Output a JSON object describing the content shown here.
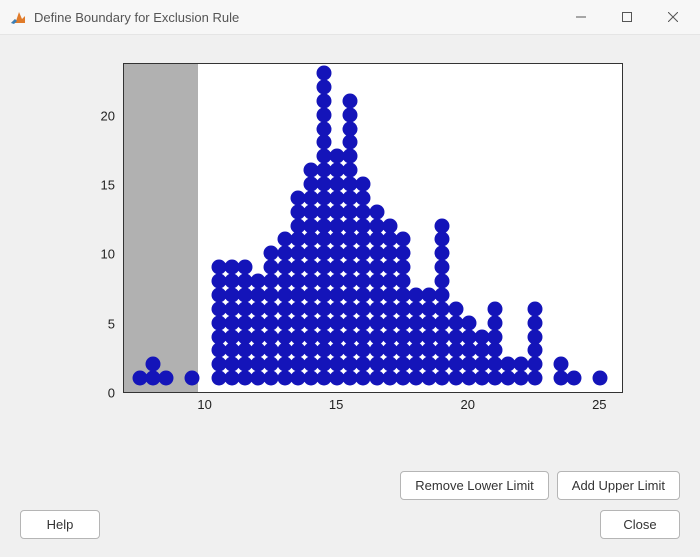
{
  "window": {
    "title": "Define Boundary for Exclusion Rule"
  },
  "buttons": {
    "remove_lower": "Remove Lower Limit",
    "add_upper": "Add Upper Limit",
    "help": "Help",
    "close": "Close"
  },
  "chart_data": {
    "type": "scatter",
    "title": "",
    "xlabel": "",
    "ylabel": "",
    "xlim": [
      6.9,
      25.9
    ],
    "ylim": [
      0,
      23.8
    ],
    "xticks": [
      10,
      15,
      20,
      25
    ],
    "yticks": [
      0,
      5,
      10,
      15,
      20
    ],
    "lower_limit": 9.7,
    "x": [
      7.5,
      8,
      8.5,
      8,
      9.5,
      10.5,
      10.5,
      10.5,
      10.5,
      10.5,
      10.5,
      10.5,
      10.5,
      10.5,
      11,
      11,
      11,
      11,
      11,
      11,
      11,
      11,
      11,
      11.5,
      11.5,
      11.5,
      11.5,
      11.5,
      11.5,
      11.5,
      11.5,
      11.5,
      12,
      12,
      12,
      12,
      12,
      12,
      12,
      12,
      12.5,
      12.5,
      12.5,
      12.5,
      12.5,
      12.5,
      12.5,
      12.5,
      12.5,
      12.5,
      13,
      13,
      13,
      13,
      13,
      13,
      13,
      13,
      13,
      13,
      13,
      13.5,
      13.5,
      13.5,
      13.5,
      13.5,
      13.5,
      13.5,
      13.5,
      13.5,
      13.5,
      13.5,
      13.5,
      13.5,
      13.5,
      14,
      14,
      14,
      14,
      14,
      14,
      14,
      14,
      14,
      14,
      14,
      14,
      14,
      14,
      14,
      14,
      14.5,
      14.5,
      14.5,
      14.5,
      14.5,
      14.5,
      14.5,
      14.5,
      14.5,
      14.5,
      14.5,
      14.5,
      14.5,
      14.5,
      14.5,
      14.5,
      14.5,
      14.5,
      14.5,
      14.5,
      14.5,
      14.5,
      14.5,
      15,
      15,
      15,
      15,
      15,
      15,
      15,
      15,
      15,
      15,
      15,
      15,
      15,
      15,
      15,
      15,
      15,
      15.5,
      15.5,
      15.5,
      15.5,
      15.5,
      15.5,
      15.5,
      15.5,
      15.5,
      15.5,
      15.5,
      15.5,
      15.5,
      15.5,
      15.5,
      15.5,
      15.5,
      15.5,
      15.5,
      15.5,
      15.5,
      16,
      16,
      16,
      16,
      16,
      16,
      16,
      16,
      16,
      16,
      16,
      16,
      16,
      16,
      16,
      16.5,
      16.5,
      16.5,
      16.5,
      16.5,
      16.5,
      16.5,
      16.5,
      16.5,
      16.5,
      16.5,
      16.5,
      16.5,
      17,
      17,
      17,
      17,
      17,
      17,
      17,
      17,
      17,
      17,
      17,
      17,
      17.5,
      17.5,
      17.5,
      17.5,
      17.5,
      17.5,
      17.5,
      17.5,
      17.5,
      17.5,
      17.5,
      18,
      18,
      18,
      18,
      18,
      18,
      18,
      18.5,
      18.5,
      18.5,
      18.5,
      18.5,
      18.5,
      18.5,
      19,
      19,
      19,
      19,
      19,
      19,
      19,
      19,
      19,
      19,
      19,
      19,
      19.5,
      19.5,
      19.5,
      19.5,
      19.5,
      19.5,
      20,
      20,
      20,
      20,
      20,
      20.5,
      20.5,
      20.5,
      20.5,
      21,
      21,
      21,
      21,
      21,
      21,
      21.5,
      21.5,
      22,
      22,
      22.5,
      22.5,
      22.5,
      22.5,
      22.5,
      22.5,
      23.5,
      23.5,
      24,
      25
    ],
    "y": [
      1,
      1,
      1,
      2,
      1,
      1,
      2,
      3,
      4,
      5,
      6,
      7,
      8,
      9,
      1,
      2,
      3,
      4,
      5,
      6,
      7,
      8,
      9,
      1,
      2,
      3,
      4,
      5,
      6,
      7,
      8,
      9,
      1,
      2,
      3,
      4,
      5,
      6,
      7,
      8,
      1,
      2,
      3,
      4,
      5,
      6,
      7,
      8,
      9,
      10,
      1,
      2,
      3,
      4,
      5,
      6,
      7,
      8,
      9,
      10,
      11,
      1,
      2,
      3,
      4,
      5,
      6,
      7,
      8,
      9,
      10,
      11,
      12,
      13,
      14,
      1,
      2,
      3,
      4,
      5,
      6,
      7,
      8,
      9,
      10,
      11,
      12,
      13,
      14,
      15,
      16,
      1,
      2,
      3,
      4,
      5,
      6,
      7,
      8,
      9,
      10,
      11,
      12,
      13,
      14,
      15,
      16,
      17,
      18,
      19,
      20,
      21,
      22,
      23,
      1,
      2,
      3,
      4,
      5,
      6,
      7,
      8,
      9,
      10,
      11,
      12,
      13,
      14,
      15,
      16,
      17,
      1,
      2,
      3,
      4,
      5,
      6,
      7,
      8,
      9,
      10,
      11,
      12,
      13,
      14,
      15,
      16,
      17,
      18,
      19,
      20,
      21,
      1,
      2,
      3,
      4,
      5,
      6,
      7,
      8,
      9,
      10,
      11,
      12,
      13,
      14,
      15,
      1,
      2,
      3,
      4,
      5,
      6,
      7,
      8,
      9,
      10,
      11,
      12,
      13,
      1,
      2,
      3,
      4,
      5,
      6,
      7,
      8,
      9,
      10,
      11,
      12,
      1,
      2,
      3,
      4,
      5,
      6,
      7,
      8,
      9,
      10,
      11,
      1,
      2,
      3,
      4,
      5,
      6,
      7,
      1,
      2,
      3,
      4,
      5,
      6,
      7,
      1,
      2,
      3,
      4,
      5,
      6,
      7,
      8,
      9,
      10,
      11,
      12,
      1,
      2,
      3,
      4,
      5,
      6,
      1,
      2,
      3,
      4,
      5,
      1,
      2,
      3,
      4,
      1,
      2,
      3,
      4,
      5,
      6,
      1,
      2,
      1,
      2,
      1,
      2,
      3,
      4,
      5,
      6,
      1,
      2,
      1,
      1
    ]
  }
}
